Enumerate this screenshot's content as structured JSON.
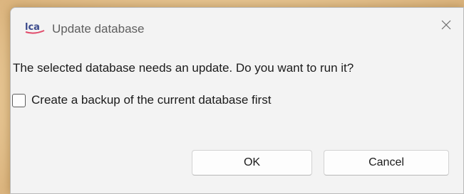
{
  "dialog": {
    "title": "Update database",
    "app_icon_text": "LCA",
    "message": "The selected database needs an update. Do you want to run it?",
    "backup_checkbox": {
      "label": "Create a backup of the current database first",
      "checked": false
    },
    "buttons": {
      "ok_label": "OK",
      "cancel_label": "Cancel"
    }
  },
  "icons": {
    "app": "lca-app-icon",
    "close": "close-icon"
  },
  "colors": {
    "dialog_bg": "#f3f3f3",
    "button_bg": "#fdfdfd",
    "app_icon_primary": "#3b4a8c",
    "app_icon_accent": "#e14b6b",
    "backdrop": "#e8c99a"
  }
}
